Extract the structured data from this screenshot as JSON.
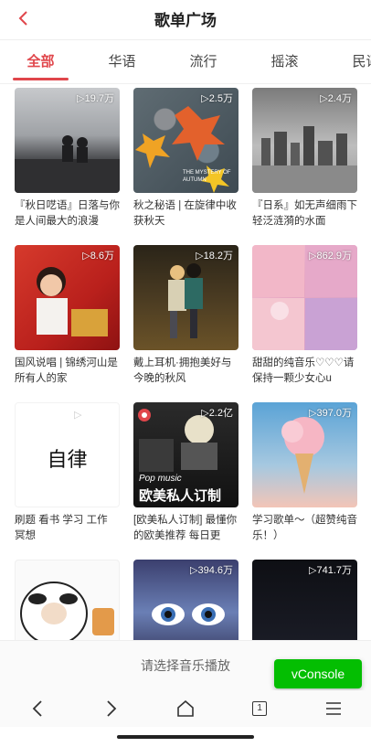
{
  "header": {
    "title": "歌单广场",
    "back_icon": "chevron-left-icon"
  },
  "tabs": [
    {
      "label": "全部",
      "active": true
    },
    {
      "label": "华语",
      "active": false
    },
    {
      "label": "流行",
      "active": false
    },
    {
      "label": "摇滚",
      "active": false
    },
    {
      "label": "民谣",
      "active": false
    }
  ],
  "playlists": [
    {
      "name": "『秋日呓语』日落与你是人间最大的浪漫",
      "count": "▷19.7万"
    },
    {
      "name": "秋之秘语 | 在旋律中收获秋天",
      "count": "▷2.5万",
      "cover_text": "THE MYSTERY OF AUTUMN"
    },
    {
      "name": "『日系』如无声细雨下轻泛涟漪的水面",
      "count": "▷2.4万"
    },
    {
      "name": "国风说唱 | 锦绣河山是所有人的家",
      "count": "▷8.6万"
    },
    {
      "name": "戴上耳机·拥抱美好与今晚的秋风",
      "count": "▷18.2万"
    },
    {
      "name": "甜甜的纯音乐♡♡♡请保持一颗少女心u",
      "count": "▷862.9万"
    },
    {
      "name": "刷题 看书 学习 工作 冥想",
      "count": "▷",
      "cover_text": "自律"
    },
    {
      "name": "[欧美私人订制] 最懂你的欧美推荐 每日更新...",
      "count": "▷2.2亿",
      "cover_text_top": "Pop music",
      "cover_text_main": "欧美私人订制"
    },
    {
      "name": "学习歌单～（超赞纯音乐！）",
      "count": "▷397.0万"
    },
    {
      "name": "",
      "count": ""
    },
    {
      "name": "",
      "count": "▷394.6万"
    },
    {
      "name": "",
      "count": "▷741.7万"
    }
  ],
  "player_hint": "请选择音乐播放",
  "vconsole_label": "vConsole",
  "browser_bar": {
    "back": "<",
    "forward": ">",
    "tab_count": "1"
  },
  "colors": {
    "accent": "#e0464b",
    "vconsole": "#04be02"
  }
}
